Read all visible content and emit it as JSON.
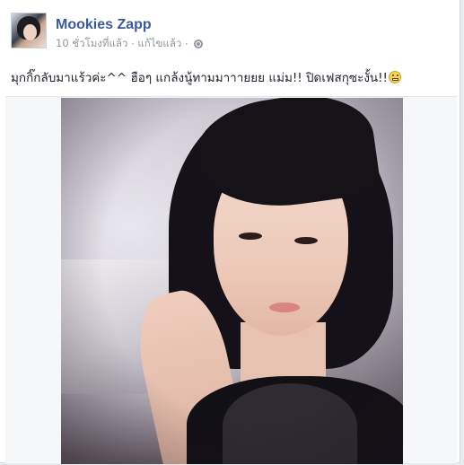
{
  "post": {
    "author": "Mookies Zapp",
    "timestamp": "10 ชั่วโมงที่แล้ว",
    "separator": "·",
    "edited_label": "แก้ไขแล้ว",
    "privacy_icon": "globe-icon",
    "text": "มุกกิ๊กลับมาแร้วค่ะ^^ ฮือๆ แกล้งนู้ทามมาาายยย แม่ม!! ปิดเฟสกุซะงั้น!!",
    "emoji_icon": "grinning-emoji-icon"
  },
  "colors": {
    "author_link": "#3b5998",
    "meta_text": "#90949c",
    "body_text": "#1d2129"
  }
}
